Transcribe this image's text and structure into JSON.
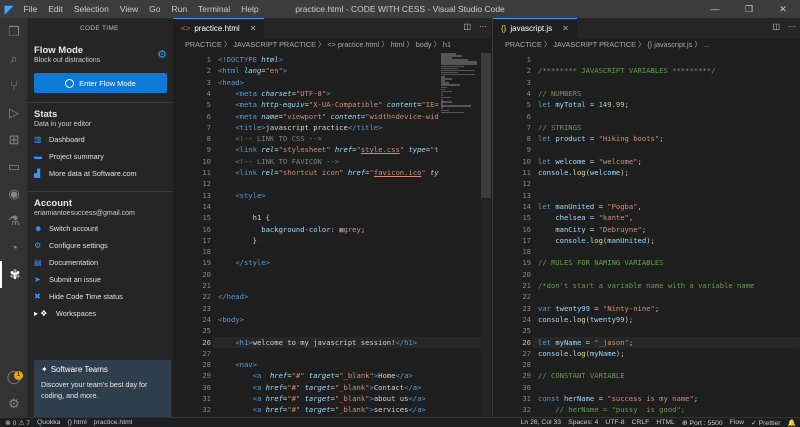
{
  "titlebar": {
    "logo": "◤",
    "menu": [
      "File",
      "Edit",
      "Selection",
      "View",
      "Go",
      "Run",
      "Terminal",
      "Help"
    ],
    "title": "practice.html - CODE WITH CESS - Visual Studio Code",
    "controls": [
      "—",
      "❐",
      "✕"
    ]
  },
  "activity_icons": [
    "files-icon",
    "search-icon",
    "source-control-icon",
    "run-debug-icon",
    "extensions-icon",
    "remote-icon",
    "github-icon",
    "test-icon",
    "timer-icon",
    "code-time-icon"
  ],
  "sidebar": {
    "header": "CODE TIME",
    "flow": {
      "title": "Flow Mode",
      "subtitle": "Block out distractions",
      "button": "Enter Flow Mode"
    },
    "stats": {
      "title": "Stats",
      "subtitle": "Data in your editor",
      "items": [
        {
          "icon": "dashboard-icon",
          "glyph": "▥",
          "label": "Dashboard"
        },
        {
          "icon": "folder-icon",
          "glyph": "▬",
          "label": "Project summary"
        },
        {
          "icon": "chart-icon",
          "glyph": "▟",
          "label": "More data at Software.com"
        }
      ]
    },
    "account": {
      "title": "Account",
      "subtitle": "eriamiantoesuccess@gmail.com",
      "items": [
        {
          "icon": "switch-account-icon",
          "glyph": "☻",
          "label": "Switch account"
        },
        {
          "icon": "settings-icon",
          "glyph": "⚙",
          "label": "Configure settings"
        },
        {
          "icon": "document-icon",
          "glyph": "▤",
          "label": "Documentation"
        },
        {
          "icon": "send-icon",
          "glyph": "➤",
          "label": "Submit an issue"
        },
        {
          "icon": "hide-icon",
          "glyph": "✖",
          "label": "Hide Code Time status"
        },
        {
          "icon": "workspace-icon",
          "glyph": "▸ ❖",
          "label": "Workspaces"
        }
      ]
    },
    "teams": {
      "title": "Software Teams",
      "text": "Discover your team's best day for coding, and more."
    }
  },
  "editor_left": {
    "tab": "practice.html",
    "breadcrumb": "PRACTICE 〉 JAVASCRIPT PRACTICE 〉 <> practice.html 〉 html 〉 body 〉 h1",
    "current_line": 26,
    "lines": [
      {
        "n": 1,
        "h": "<span class='tag'>&lt;!DOCTYPE</span> <span class='attr ital'>html</span><span class='tag'>&gt;</span>"
      },
      {
        "n": 2,
        "h": "<span class='tag'>&lt;html</span> <span class='attr ital'>lang</span>=<span class='str'>\"en\"</span><span class='tag'>&gt;</span>"
      },
      {
        "n": 3,
        "h": "<span class='tag'>&lt;head&gt;</span>"
      },
      {
        "n": 4,
        "h": "    <span class='tag'>&lt;meta</span> <span class='attr ital'>charset</span>=<span class='str'>\"UTF-8\"</span><span class='tag'>&gt;</span>"
      },
      {
        "n": 5,
        "h": "    <span class='tag'>&lt;meta</span> <span class='attr ital'>http-equiv</span>=<span class='str'>\"X-UA-Compatible\"</span> <span class='attr ital'>content</span>=<span class='str'>\"IE=</span>"
      },
      {
        "n": 6,
        "h": "    <span class='tag'>&lt;meta</span> <span class='attr ital'>name</span>=<span class='str'>\"viewport\"</span> <span class='attr ital'>content</span>=<span class='str'>\"width=device-wid</span>"
      },
      {
        "n": 7,
        "h": "    <span class='tag'>&lt;title&gt;</span>javascript practice<span class='tag'>&lt;/title&gt;</span>"
      },
      {
        "n": 8,
        "h": "    <span class='grey'>&lt;!-- LINK TO CSS --&gt;</span>"
      },
      {
        "n": 9,
        "h": "    <span class='tag'>&lt;link</span> <span class='attr ital'>rel</span>=<span class='str'>\"stylesheet\"</span> <span class='attr ital'>href</span>=<span class='str'>\"<span class='und'>style.css</span>\"</span> <span class='attr ital'>type</span>=<span class='str'>\"t</span>"
      },
      {
        "n": 10,
        "h": "    <span class='grey'>&lt;!-- LINK TO FAVICON --&gt;</span>"
      },
      {
        "n": 11,
        "h": "    <span class='tag'>&lt;link</span> <span class='attr ital'>rel</span>=<span class='str'>\"shortcut icon\"</span> <span class='attr ital'>href</span>=<span class='str'>\"<span class='und'>favicon.ico</span>\"</span> <span class='attr ital'>ty</span>"
      },
      {
        "n": 12,
        "h": ""
      },
      {
        "n": 13,
        "h": "    <span class='tag'>&lt;style&gt;</span>"
      },
      {
        "n": 14,
        "h": ""
      },
      {
        "n": 15,
        "h": "        <span class='fn'>h1</span> {"
      },
      {
        "n": 16,
        "h": "          <span class='attr'>background-color</span>: <span style='color:#808080'>■</span><span class='str'>grey</span>;"
      },
      {
        "n": 17,
        "h": "        }"
      },
      {
        "n": 18,
        "h": ""
      },
      {
        "n": 19,
        "h": "    <span class='tag'>&lt;/style&gt;</span>"
      },
      {
        "n": 20,
        "h": ""
      },
      {
        "n": 21,
        "h": ""
      },
      {
        "n": 22,
        "h": "<span class='tag'>&lt;/head&gt;</span>"
      },
      {
        "n": 23,
        "h": ""
      },
      {
        "n": 24,
        "h": "<span class='tag'>&lt;body&gt;</span>"
      },
      {
        "n": 25,
        "h": ""
      },
      {
        "n": 26,
        "h": "    <span class='tag'>&lt;h1&gt;</span>welcome to my javascript session!<span class='tag'>&lt;/h1&gt;</span>"
      },
      {
        "n": 27,
        "h": ""
      },
      {
        "n": 28,
        "h": "    <span class='tag'>&lt;nav&gt;</span>"
      },
      {
        "n": 29,
        "h": "        <span class='tag'>&lt;a</span>  <span class='attr ital'>href</span>=<span class='str'>\"#\"</span> <span class='attr ital'>target</span>=<span class='str'>\"_blank\"</span><span class='tag'>&gt;</span>Home<span class='tag'>&lt;/a&gt;</span>"
      },
      {
        "n": 30,
        "h": "        <span class='tag'>&lt;a</span> <span class='attr ital'>href</span>=<span class='str'>\"#\"</span> <span class='attr ital'>target</span>=<span class='str'>\"_blank\"</span><span class='tag'>&gt;</span>Contact<span class='tag'>&lt;/a&gt;</span>"
      },
      {
        "n": 31,
        "h": "        <span class='tag'>&lt;a</span> <span class='attr ital'>href</span>=<span class='str'>\"#\"</span> <span class='attr ital'>target</span>=<span class='str'>\"_blank\"</span><span class='tag'>&gt;</span>about us<span class='tag'>&lt;/a&gt;</span>"
      },
      {
        "n": 32,
        "h": "        <span class='tag'>&lt;a</span> <span class='attr ital'>href</span>=<span class='str'>\"#\"</span> <span class='attr ital'>target</span>=<span class='str'>\"_blank\"</span><span class='tag'>&gt;</span>services<span class='tag'>&lt;/a&gt;</span>"
      },
      {
        "n": 33,
        "h": "    <span class='tag'>&lt;/nav&gt;</span>"
      }
    ]
  },
  "editor_right": {
    "tab": "javascript.js",
    "breadcrumb": "PRACTICE 〉 JAVASCRIPT PRACTICE 〉 {} javascript.js 〉 ...",
    "current_line": 26,
    "lines": [
      {
        "n": 1,
        "h": ""
      },
      {
        "n": 2,
        "h": "<span class='cm'>/******** JAVASCRIPT VARIABLES *********/</span>"
      },
      {
        "n": 3,
        "h": ""
      },
      {
        "n": 4,
        "h": "<span class='cm'>// NUMBERS</span>"
      },
      {
        "n": 5,
        "h": "<span class='kw'>let</span> <span class='var'>myTotal</span> = <span class='num'>149.99</span>;"
      },
      {
        "n": 6,
        "h": ""
      },
      {
        "n": 7,
        "h": "<span class='cm'>// STRINGS</span>"
      },
      {
        "n": 8,
        "h": "<span class='kw'>let</span> <span class='var'>product</span> = <span class='str'>\"Hiking boots\"</span>;"
      },
      {
        "n": 9,
        "h": ""
      },
      {
        "n": 10,
        "h": "<span class='kw'>let</span> <span class='var'>welcome</span> = <span class='str'>\"welcome\"</span>;"
      },
      {
        "n": 11,
        "h": "<span class='var'>console</span>.<span class='fn'>log</span>(<span class='var'>welcome</span>);"
      },
      {
        "n": 12,
        "h": ""
      },
      {
        "n": 13,
        "h": ""
      },
      {
        "n": 14,
        "h": "<span class='kw'>let</span> <span class='var'>manUnited</span> = <span class='str'>\"Pogba\"</span>,"
      },
      {
        "n": 15,
        "h": "    <span class='var'>chelsea</span> = <span class='str'>\"kante\"</span>,"
      },
      {
        "n": 16,
        "h": "    <span class='var'>manCity</span> = <span class='str'>\"Debruyne\"</span>;"
      },
      {
        "n": 17,
        "h": "    <span class='var'>console</span>.<span class='fn'>log</span>(<span class='var'>manUnited</span>);"
      },
      {
        "n": 18,
        "h": ""
      },
      {
        "n": 19,
        "h": "<span class='cm'>// RULES FOR NAMING VARIABLES</span>"
      },
      {
        "n": 20,
        "h": ""
      },
      {
        "n": 21,
        "h": "<span class='cm'>/*don't start a variable name with a variable name</span>"
      },
      {
        "n": 22,
        "h": ""
      },
      {
        "n": 23,
        "h": "<span class='kw'>var</span> <span class='var'>twenty99</span> = <span class='str'>\"Ninty-nine\"</span>;"
      },
      {
        "n": 24,
        "h": "<span class='var'>console</span>.<span class='fn'>log</span>(<span class='var'>twenty99</span>);"
      },
      {
        "n": 25,
        "h": ""
      },
      {
        "n": 26,
        "h": "<span class='kw'>let</span> <span class='var'>myName</span> = <span class='str'>\"_jason\"</span>;"
      },
      {
        "n": 27,
        "h": "<span class='var'>console</span>.<span class='fn'>log</span>(<span class='var'>myName</span>);"
      },
      {
        "n": 28,
        "h": ""
      },
      {
        "n": 29,
        "h": "<span class='cm'>// CONSTANT VARIABLE</span>"
      },
      {
        "n": 30,
        "h": ""
      },
      {
        "n": 31,
        "h": "<span class='kw'>const</span> <span class='var'>herName</span> = <span class='str'>\"success is my name\"</span>;"
      },
      {
        "n": 32,
        "h": "    <span class='cm'>// herName = \"pussy  is good\";</span>"
      },
      {
        "n": 33,
        "h": "<span class='var'>console</span>.<span class='fn'>log</span>(<span class='var'>herName</span>);"
      }
    ]
  },
  "statusbar": {
    "left": [
      "⊗ 0 ⚠ 7",
      "Quokka",
      "{} html",
      "practice.html"
    ],
    "right": [
      "Ln 26, Col 33",
      "Spaces: 4",
      "UTF-8",
      "CRLF",
      "HTML",
      "⊕ Port : 5500",
      "Flow",
      "✓ Prettier",
      "🔔"
    ]
  },
  "notification_count": "1",
  "colors": {
    "accent": "#0e79d6",
    "activity_bg": "#333333",
    "sidebar_bg": "#252526",
    "editor_bg": "#1e1e1e",
    "titlebar_bg": "#3c3c3c"
  }
}
